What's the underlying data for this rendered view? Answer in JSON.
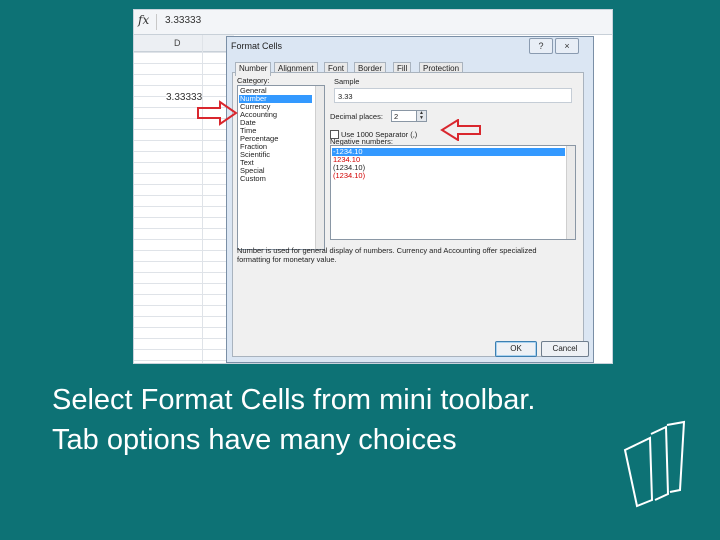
{
  "spreadsheet": {
    "fx_symbol": "fx",
    "formula_value": "3.33333",
    "column_header": "D",
    "cell_value": "3.33333"
  },
  "dialog": {
    "title": "Format Cells",
    "help_button": "?",
    "close_button": "×",
    "tabs": [
      "Number",
      "Alignment",
      "Font",
      "Border",
      "Fill",
      "Protection"
    ],
    "active_tab": "Number",
    "category_label": "Category:",
    "categories": [
      "General",
      "Number",
      "Currency",
      "Accounting",
      "Date",
      "Time",
      "Percentage",
      "Fraction",
      "Scientific",
      "Text",
      "Special",
      "Custom"
    ],
    "selected_category": "Number",
    "sample_label": "Sample",
    "sample_value": "3.33",
    "decimal_places_label": "Decimal places:",
    "decimal_places_value": "2",
    "use_separator_label": "Use 1000 Separator (,)",
    "use_separator_checked": false,
    "negative_numbers_label": "Negative numbers:",
    "negative_numbers": [
      {
        "text": "-1234.10",
        "color": "#ffffff",
        "selected": true
      },
      {
        "text": "1234.10",
        "color": "#d10000",
        "selected": false
      },
      {
        "text": "(1234.10)",
        "color": "#222222",
        "selected": false
      },
      {
        "text": "(1234.10)",
        "color": "#d10000",
        "selected": false
      }
    ],
    "description": "Number is used for general display of numbers. Currency and Accounting offer specialized formatting for monetary value.",
    "ok_label": "OK",
    "cancel_label": "Cancel"
  },
  "annotations": {
    "arrow_color": "#d9272e"
  },
  "slide": {
    "background": "#0d7275",
    "caption_line1": "Select Format Cells from mini toolbar.",
    "caption_line2": "Tab options have many choices"
  }
}
